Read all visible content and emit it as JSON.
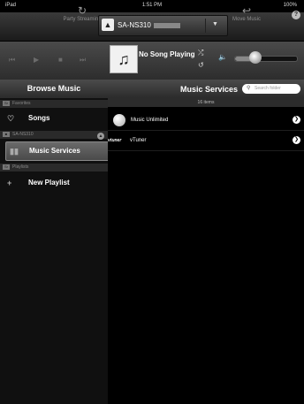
{
  "status_bar": {
    "carrier": "iPad",
    "time": "1:51 PM",
    "battery": "100%"
  },
  "top_bar": {
    "party_label": "Party Streaming",
    "move_label": "Move Music",
    "device_name": "SA-NS310",
    "info_icon": "info-icon"
  },
  "player": {
    "now_playing": "No Song Playing",
    "volume_level": 0.32
  },
  "browse": {
    "title": "Browse Music",
    "sections": {
      "favorites": "Favorites",
      "device": "SA-NS310",
      "playlists": "Playlists"
    },
    "items": {
      "songs": "Songs",
      "music_services": "Music Services",
      "new_playlist": "New Playlist"
    }
  },
  "services": {
    "title": "Music Services",
    "search_placeholder": "Search folder",
    "count": "16 items",
    "list": [
      {
        "name": "Music Unlimited",
        "icon": "music-unlimited-logo"
      },
      {
        "name": "vTuner",
        "logo_text": "vtuner"
      }
    ]
  },
  "colors": {
    "selected_bg": "#5a5a5a",
    "header_bg": "#3b3b3b"
  }
}
